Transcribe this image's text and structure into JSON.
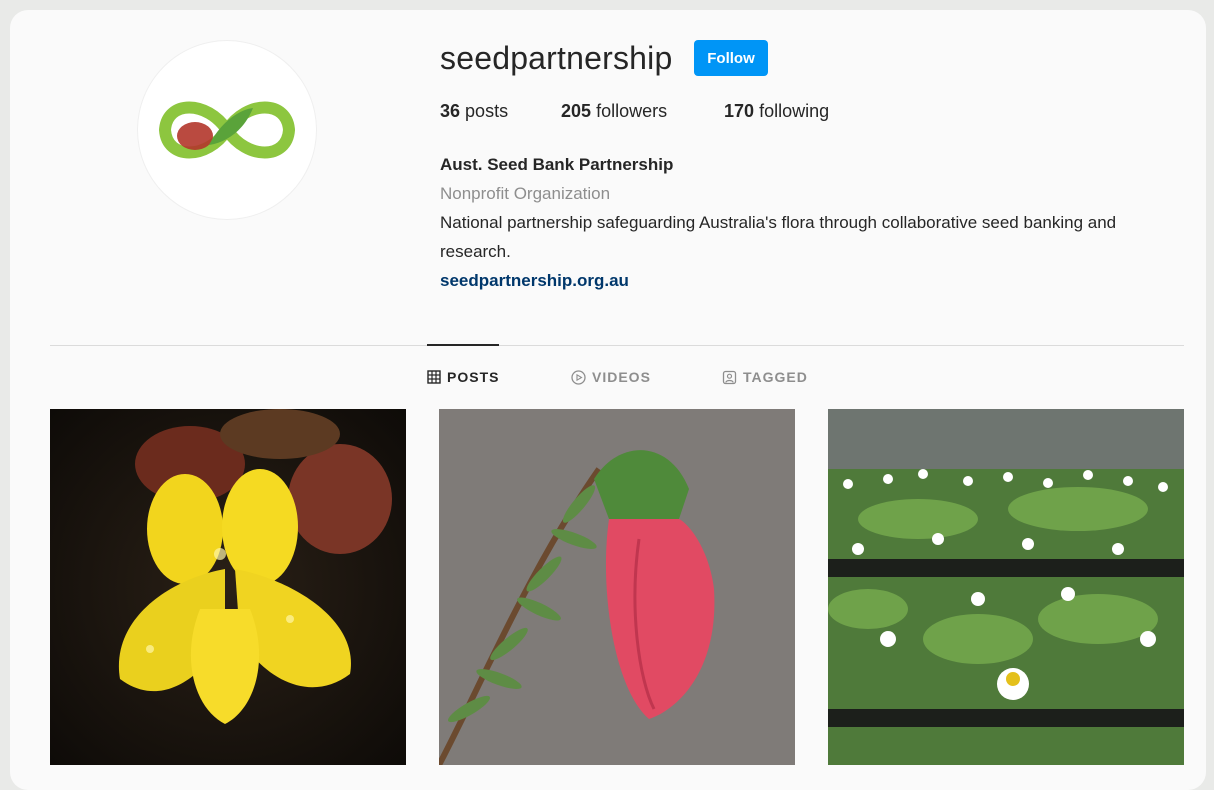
{
  "profile": {
    "username": "seedpartnership",
    "follow_label": "Follow",
    "stats": {
      "posts_count": "36",
      "posts_label": "posts",
      "followers_count": "205",
      "followers_label": "followers",
      "following_count": "170",
      "following_label": "following"
    },
    "display_name": "Aust. Seed Bank Partnership",
    "category": "Nonprofit Organization",
    "bio": "National partnership safeguarding Australia's flora through collaborative seed banking and research.",
    "website": "seedpartnership.org.au"
  },
  "tabs": [
    {
      "label": "POSTS",
      "icon": "grid-icon",
      "active": true
    },
    {
      "label": "VIDEOS",
      "icon": "play-circle-icon",
      "active": false
    },
    {
      "label": "TAGGED",
      "icon": "tagged-icon",
      "active": false
    }
  ],
  "posts": [
    {
      "subject": "yellow-flower-photo"
    },
    {
      "subject": "pink-bell-flower-photo"
    },
    {
      "subject": "daisy-seedlings-photo"
    }
  ],
  "colors": {
    "follow_button": "#0095f6",
    "link": "#00376b",
    "muted_text": "#8e8e8e",
    "logo_green": "#8dc63f",
    "logo_red": "#b2362b"
  }
}
